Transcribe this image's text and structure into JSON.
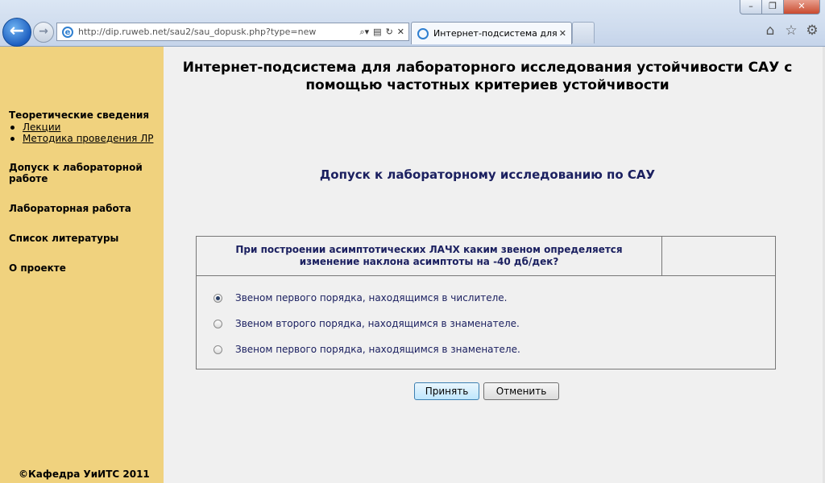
{
  "browser": {
    "address_url": "http://dip.ruweb.net/sau2/sau_dopusk.php?type=new",
    "tab_title": "Интернет-подсистема для ла...",
    "window_controls": [
      "minimize",
      "maximize",
      "close"
    ],
    "toolbar_icons": [
      "home-icon",
      "star-icon",
      "gear-icon"
    ]
  },
  "sidebar": {
    "theory_heading": "Теоретические сведения",
    "theory_links": [
      "Лекции",
      "Методика проведения ЛР"
    ],
    "admission": "Допуск к лабораторной работе",
    "lab_work": "Лабораторная работа",
    "literature": "Список литературы",
    "about": "О проекте",
    "copyright": "©Кафедра УиИТС 2011"
  },
  "main": {
    "title": "Интернет-подсистема для лабораторного исследования устойчивости САУ с помощью частотных критериев устойчивости",
    "subtitle": "Допуск к лабораторному исследованию по САУ",
    "question": "При построении асимптотических ЛАЧХ каким звеном определяется изменение наклона асимптоты на -40 дб/дек?",
    "options": [
      {
        "label": "Звеном первого порядка, находящимся в числителе.",
        "checked": true
      },
      {
        "label": "Звеном второго порядка, находящимся в знаменателе.",
        "checked": false
      },
      {
        "label": "Звеном первого порядка, находящимся в знаменателе.",
        "checked": false
      }
    ],
    "accept_label": "Принять",
    "cancel_label": "Отменить"
  },
  "colors": {
    "sidebar_bg": "#f0d27e",
    "main_bg": "#f0f0f0",
    "accent_text": "#1b2060"
  }
}
